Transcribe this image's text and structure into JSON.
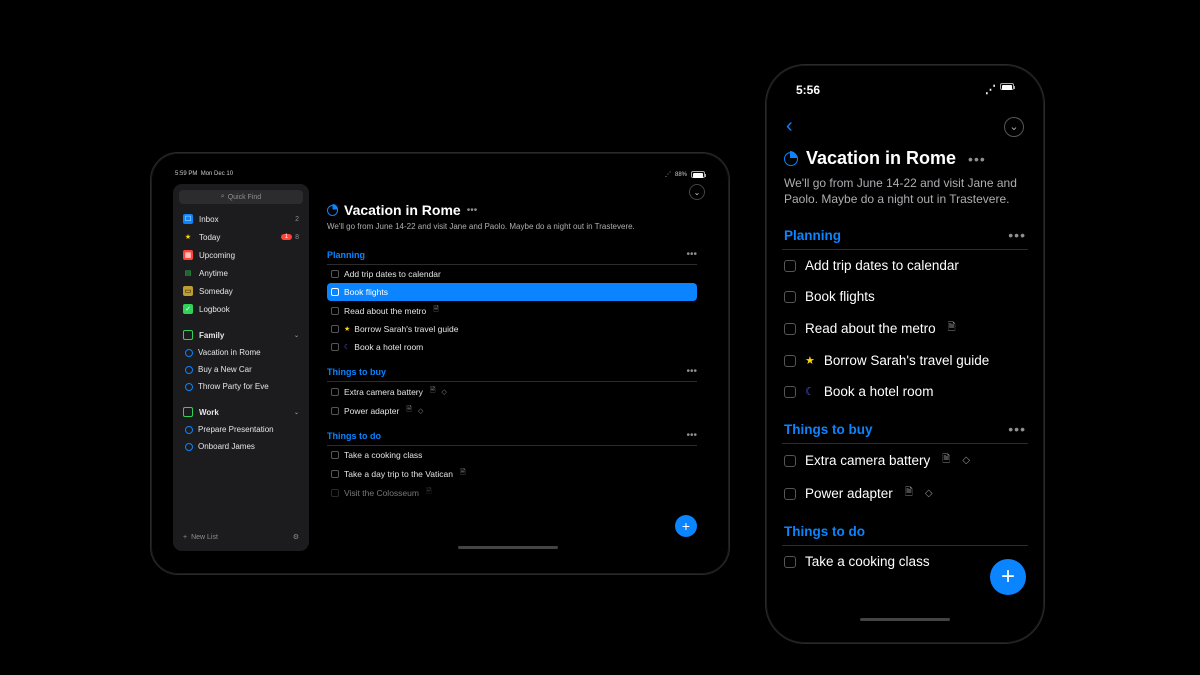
{
  "tablet": {
    "status": {
      "time": "5:59 PM",
      "date": "Mon Dec 10",
      "battery": "88%"
    },
    "quickfind": "Quick Find",
    "sidebar": {
      "items": [
        {
          "label": "Inbox",
          "count": "2"
        },
        {
          "label": "Today",
          "badge": "1",
          "count": "8"
        },
        {
          "label": "Upcoming"
        },
        {
          "label": "Anytime"
        },
        {
          "label": "Someday"
        },
        {
          "label": "Logbook"
        }
      ],
      "areas": [
        {
          "name": "Family",
          "projects": [
            "Vacation in Rome",
            "Buy a New Car",
            "Throw Party for Eve"
          ]
        },
        {
          "name": "Work",
          "projects": [
            "Prepare Presentation",
            "Onboard James"
          ]
        }
      ],
      "newlist": "New List"
    },
    "project": {
      "title": "Vacation in Rome",
      "notes": "We'll go from June 14-22 and visit Jane and Paolo. Maybe do a night out in Trastevere.",
      "sections": [
        {
          "heading": "Planning",
          "tasks": [
            {
              "title": "Add trip dates to calendar"
            },
            {
              "title": "Book flights",
              "selected": true
            },
            {
              "title": "Read about the metro",
              "hasNotes": true
            },
            {
              "title": "Borrow Sarah's travel guide",
              "star": true
            },
            {
              "title": "Book a hotel room",
              "moon": true
            }
          ]
        },
        {
          "heading": "Things to buy",
          "tasks": [
            {
              "title": "Extra camera battery",
              "hasNotes": true,
              "hasTag": true
            },
            {
              "title": "Power adapter",
              "hasNotes": true,
              "hasTag": true
            }
          ]
        },
        {
          "heading": "Things to do",
          "tasks": [
            {
              "title": "Take a cooking class"
            },
            {
              "title": "Take a day trip to the Vatican",
              "hasNotes": true
            },
            {
              "title": "Visit the Colosseum",
              "hasNotes": true
            }
          ]
        }
      ]
    }
  },
  "phone": {
    "status": {
      "time": "5:56"
    },
    "project": {
      "title": "Vacation in Rome",
      "notes": "We'll go from June 14-22 and visit Jane and Paolo. Maybe do a night out in Trastevere.",
      "sections": [
        {
          "heading": "Planning",
          "tasks": [
            {
              "title": "Add trip dates to calendar"
            },
            {
              "title": "Book flights"
            },
            {
              "title": "Read about the metro",
              "hasNotes": true
            },
            {
              "title": "Borrow Sarah's travel guide",
              "star": true
            },
            {
              "title": "Book a hotel room",
              "moon": true
            }
          ]
        },
        {
          "heading": "Things to buy",
          "tasks": [
            {
              "title": "Extra camera battery",
              "hasNotes": true,
              "hasTag": true
            },
            {
              "title": "Power adapter",
              "hasNotes": true,
              "hasTag": true
            }
          ]
        },
        {
          "heading": "Things to do",
          "tasks": [
            {
              "title": "Take a cooking class"
            }
          ]
        }
      ]
    }
  }
}
